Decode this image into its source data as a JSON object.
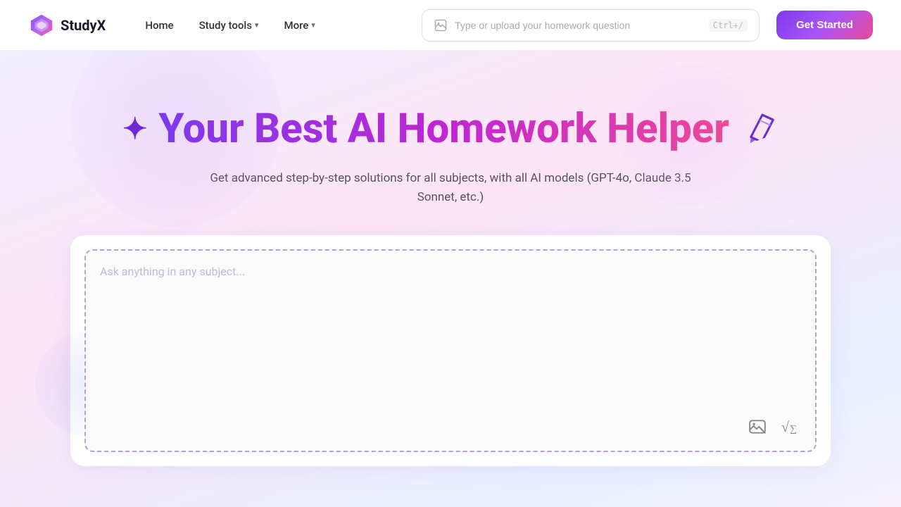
{
  "navbar": {
    "logo_text": "StudyX",
    "nav_home": "Home",
    "nav_study_tools": "Study tools",
    "nav_more": "More",
    "search_placeholder": "Type or upload your homework question",
    "search_shortcut": "Ctrl+/",
    "get_started": "Get Started"
  },
  "hero": {
    "title": "Your Best AI Homework Helper",
    "subtitle": "Get advanced step-by-step solutions for all subjects, with all AI models (GPT-4o, Claude 3.5 Sonnet, etc.)",
    "input_placeholder": "Ask anything in any subject...",
    "star_icon": "✦",
    "pencil_icon": "✏"
  }
}
